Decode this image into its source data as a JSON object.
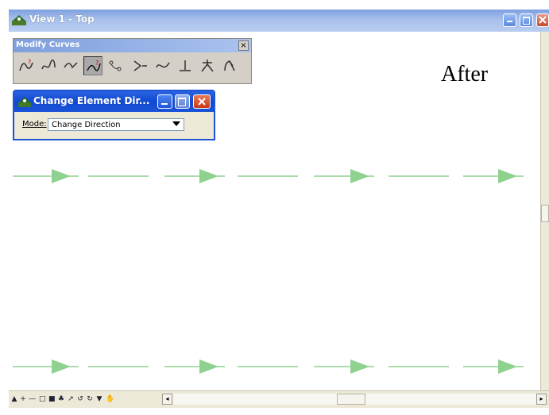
{
  "window": {
    "title": "View 1 - Top",
    "annotation": "After"
  },
  "modify_curves": {
    "title": "Modify Curves",
    "close_label": "×",
    "tools": [
      {
        "name": "modify-curve-tool"
      },
      {
        "name": "spiral-curve-tool"
      },
      {
        "name": "curve-vertex-tool"
      },
      {
        "name": "change-element-direction-tool",
        "active": true
      },
      {
        "name": "curve-point-tool"
      },
      {
        "name": "curve-break-tool"
      },
      {
        "name": "curve-reshape-tool"
      },
      {
        "name": "perpendicular-tool"
      },
      {
        "name": "bisect-tool"
      },
      {
        "name": "extend-curve-tool"
      }
    ]
  },
  "dialog": {
    "title": "Change Element Dir...",
    "mode_label": "Mode:",
    "mode_value": "Change Direction"
  },
  "lines": {
    "color": "#8fd18f",
    "arrow_color": "#8fd18f"
  },
  "bottom_bar": {
    "icons": [
      "pan-icon",
      "add-icon",
      "line-icon",
      "rect-icon",
      "fill-icon",
      "tree-icon",
      "draw-icon",
      "undo-icon",
      "redo-icon",
      "filter-icon",
      "hand-icon"
    ],
    "left_arrow": "◂",
    "right_arrow": "▸"
  }
}
